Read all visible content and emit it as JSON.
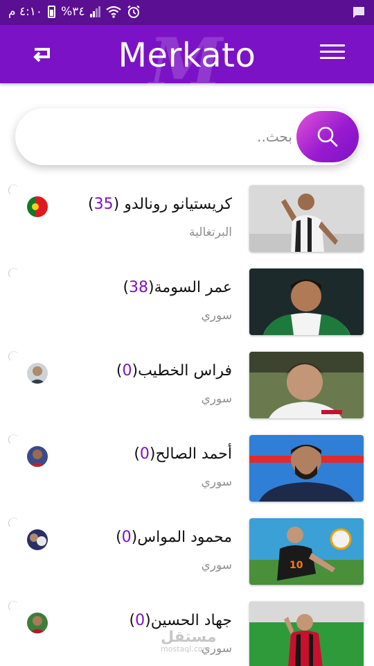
{
  "status_bar": {
    "time": "٤:١٠ م",
    "battery": "%٣٤",
    "icons": [
      "alarm-icon",
      "wifi-icon",
      "signal-icon",
      "battery-icon",
      "message-icon"
    ]
  },
  "app_bar": {
    "title": "Merkato",
    "logo_letter": "M",
    "colors": {
      "primary": "#7c12c6",
      "status": "#5b0f93",
      "accent": "#7c12c6"
    }
  },
  "search": {
    "placeholder": "بحث..",
    "value": ""
  },
  "players": [
    {
      "name": "كريستيانو رونالدو",
      "count": "35",
      "nationality": "البرتغالية",
      "flag": "portugal"
    },
    {
      "name": "عمر السومة",
      "count": "38",
      "nationality": "سوري",
      "flag": "none"
    },
    {
      "name": "فراس الخطيب",
      "count": "0",
      "nationality": "سوري",
      "flag": "club"
    },
    {
      "name": "أحمد الصالح",
      "count": "0",
      "nationality": "سوري",
      "flag": "club"
    },
    {
      "name": "محمود المواس",
      "count": "0",
      "nationality": "سوري",
      "flag": "club"
    },
    {
      "name": "جهاد الحسين",
      "count": "0",
      "nationality": "سوري",
      "flag": "club"
    }
  ],
  "watermark": {
    "arabic": "مستقل",
    "latin": "mostaql.com"
  }
}
